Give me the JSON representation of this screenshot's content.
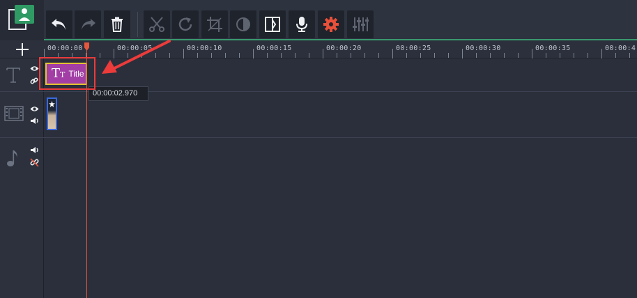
{
  "toolbar": {
    "buttons": [
      {
        "name": "undo",
        "icon": "undo-icon",
        "enabled": true
      },
      {
        "name": "redo",
        "icon": "redo-icon",
        "enabled": false
      },
      {
        "name": "delete",
        "icon": "trash-icon",
        "enabled": true
      },
      {
        "name": "cut",
        "icon": "scissors-icon",
        "enabled": false
      },
      {
        "name": "rotate",
        "icon": "rotate-icon",
        "enabled": false
      },
      {
        "name": "crop",
        "icon": "crop-icon",
        "enabled": false
      },
      {
        "name": "color-adjust",
        "icon": "contrast-icon",
        "enabled": false
      },
      {
        "name": "transition",
        "icon": "transition-icon",
        "enabled": true
      },
      {
        "name": "record-audio",
        "icon": "microphone-icon",
        "enabled": true
      },
      {
        "name": "clip-properties",
        "icon": "gear-icon",
        "enabled": true,
        "color": "#e8503a"
      },
      {
        "name": "equalizer",
        "icon": "equalizer-icon",
        "enabled": false
      }
    ]
  },
  "ruler": {
    "labels": [
      "00:00:00",
      "00:00:05",
      "00:00:10",
      "00:00:15",
      "00:00:20",
      "00:00:25",
      "00:00:30",
      "00:00:35",
      "00:00:4"
    ]
  },
  "tracks": {
    "title_track": {
      "icon": "text-track-icon"
    },
    "video_track": {
      "icon": "film-icon"
    },
    "audio_track": {
      "icon": "music-note-icon"
    }
  },
  "title_clip": {
    "icon_text": "T",
    "label": "Title"
  },
  "tooltip": {
    "time": "00:00:02.970"
  },
  "colors": {
    "accent_green": "#3a9a6f",
    "playhead": "#e4573f",
    "title_clip": "#a23ea5",
    "selection": "#e5c233",
    "annotation": "#ec3b3b"
  }
}
